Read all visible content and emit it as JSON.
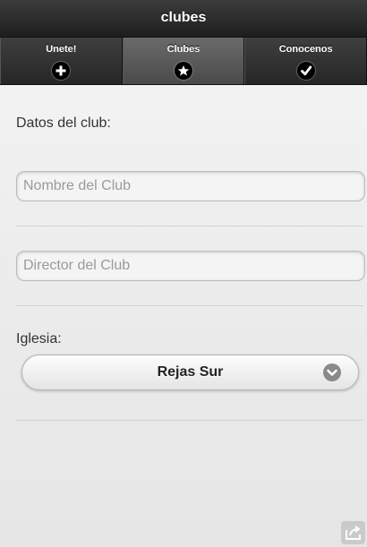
{
  "header": {
    "title": "clubes"
  },
  "navbar": {
    "tabs": [
      {
        "label": "Unete!",
        "icon": "plus-icon",
        "active": false
      },
      {
        "label": "Clubes",
        "icon": "star-icon",
        "active": true
      },
      {
        "label": "Conocenos",
        "icon": "check-icon",
        "active": false
      }
    ]
  },
  "form": {
    "section_title": "Datos del club:",
    "club_name": {
      "value": "",
      "placeholder": "Nombre del Club"
    },
    "director": {
      "value": "",
      "placeholder": "Director del Club"
    },
    "church": {
      "label": "Iglesia:",
      "selected": "Rejas Sur",
      "icon": "chevron-down-icon"
    }
  },
  "footer": {
    "share_icon": "share-icon"
  }
}
